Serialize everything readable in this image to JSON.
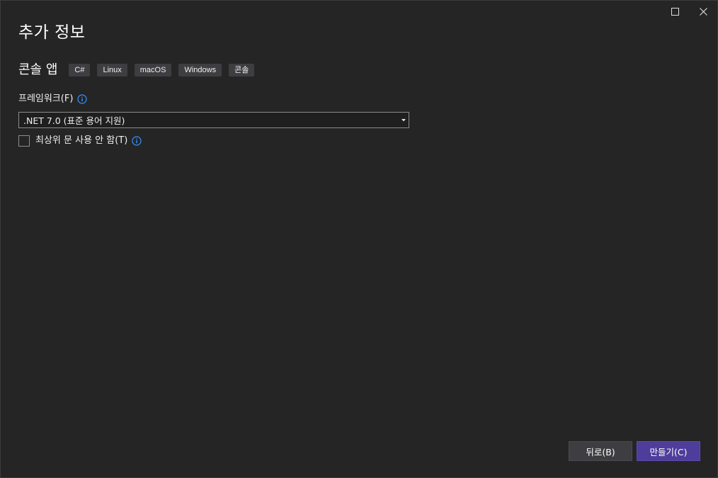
{
  "dialog": {
    "title": "추가 정보"
  },
  "window_controls": {
    "maximize_icon": "maximize-icon",
    "close_icon": "close-icon"
  },
  "template": {
    "name": "콘솔 앱",
    "tags": [
      "C#",
      "Linux",
      "macOS",
      "Windows",
      "콘솔"
    ]
  },
  "framework": {
    "label": "프레임워크(F)",
    "info_icon": "info-icon",
    "selected": ".NET 7.0 (표준 용어 지원)"
  },
  "top_level_statements": {
    "label": "최상위 문 사용 안 함(T)",
    "checked": false,
    "info_icon": "info-icon"
  },
  "buttons": {
    "back": "뒤로(B)",
    "create": "만들기(C)"
  },
  "colors": {
    "background": "#252526",
    "accent": "#4e3d9a",
    "info_icon": "#3794ff"
  }
}
